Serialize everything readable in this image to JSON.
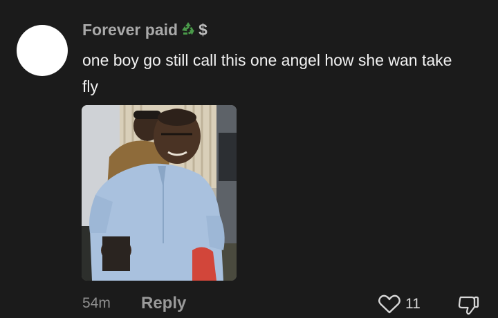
{
  "comment": {
    "username": "Forever paid",
    "username_suffix": "$",
    "username_emoji": "recycle-icon",
    "text": "one boy go still call this one angel how she wan take fly",
    "time": "54m",
    "reply_label": "Reply",
    "like_count": "11"
  },
  "colors": {
    "background": "#1b1b1b",
    "username": "#a9a9a9",
    "text": "#f2f2f2",
    "muted": "#8f8f8f",
    "recycle_green": "#4a9a4a"
  }
}
